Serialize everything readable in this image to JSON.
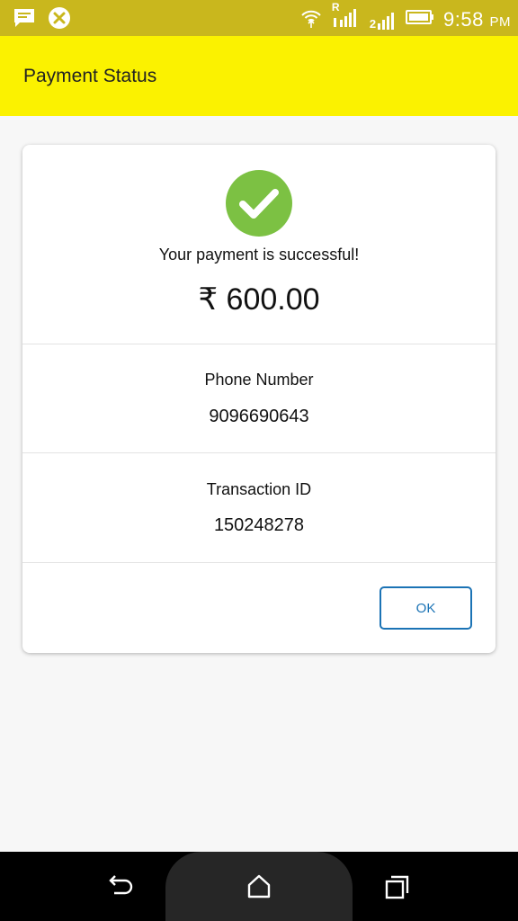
{
  "status_bar": {
    "time": "9:58",
    "ampm": "PM",
    "icons": [
      "message-icon",
      "app-notification-icon",
      "wifi-icon",
      "signal-icon",
      "signal-2-icon",
      "battery-icon"
    ],
    "sim1_label": "R",
    "sim2_label": "2"
  },
  "app_bar": {
    "title": "Payment Status",
    "background": "#fbf200"
  },
  "card": {
    "success_message": "Your payment is successful!",
    "amount": "₹ 600.00",
    "phone_label": "Phone Number",
    "phone_value": "9096690643",
    "transaction_label": "Transaction ID",
    "transaction_value": "150248278",
    "ok_label": "OK",
    "success_color": "#7cc143",
    "accent": "#1b73b5"
  },
  "nav_bar": {
    "icons": [
      "back-icon",
      "home-icon",
      "recent-apps-icon"
    ]
  }
}
